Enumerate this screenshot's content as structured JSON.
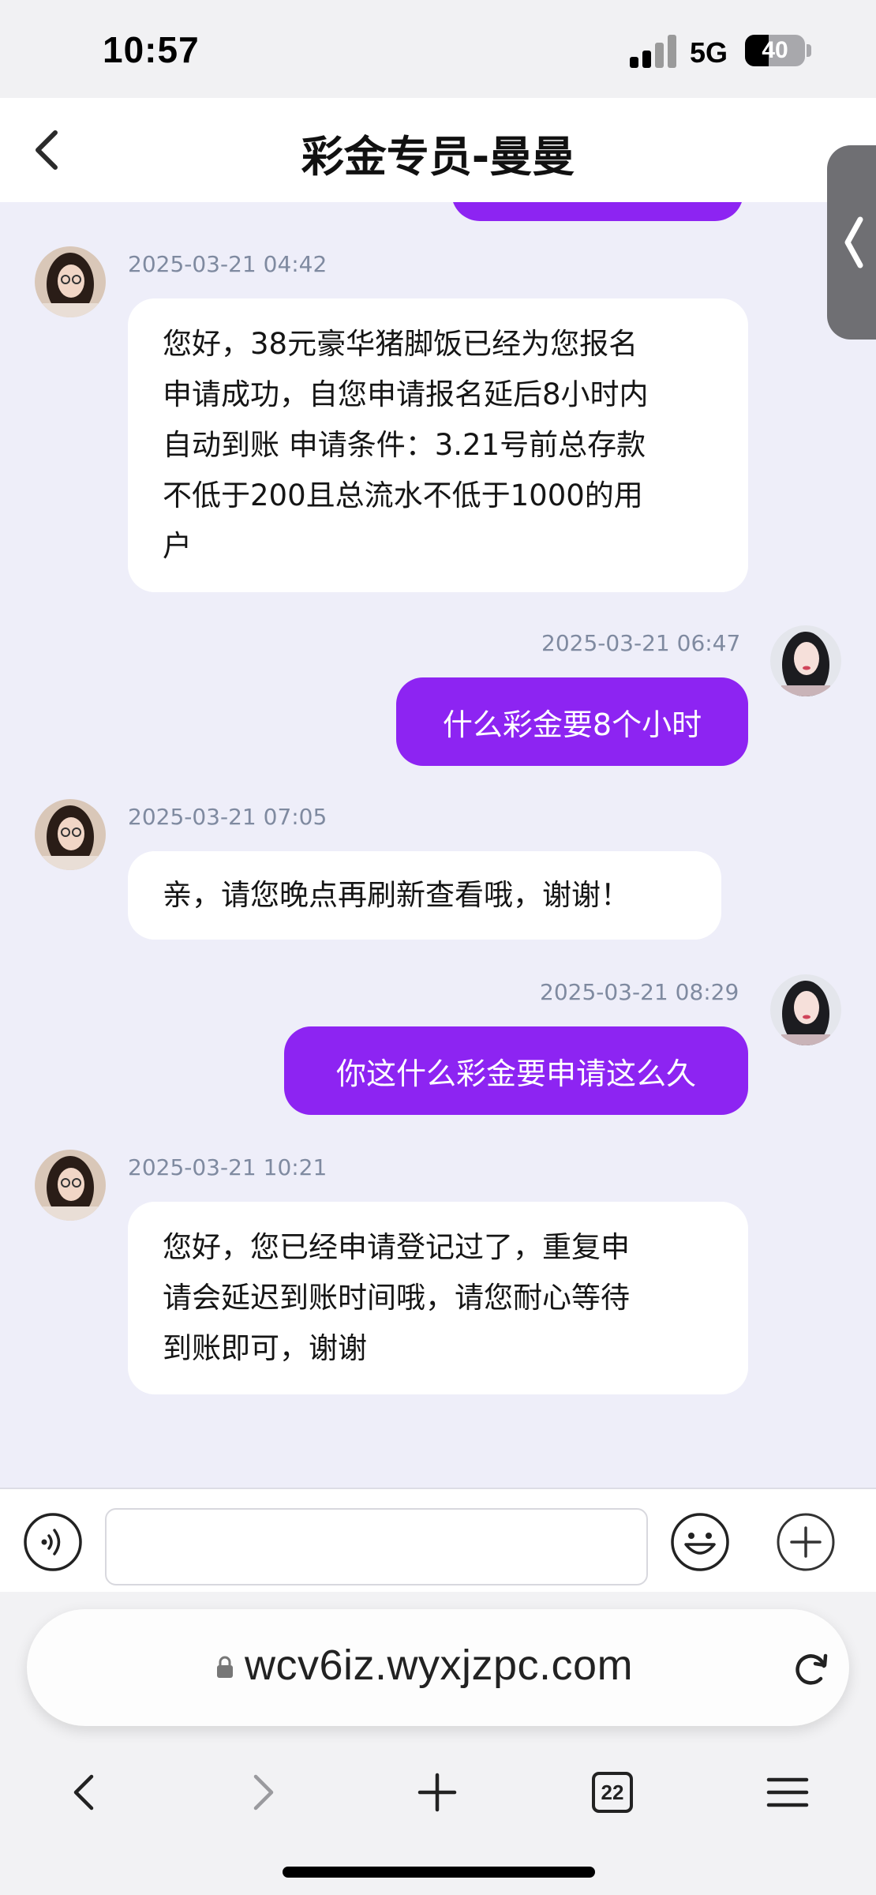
{
  "status_bar": {
    "time": "10:57",
    "network": "5G",
    "battery_level": "40"
  },
  "header": {
    "title": "彩金专员-曼曼"
  },
  "messages": [
    {
      "sender": "agent",
      "timestamp": "2025-03-21 04:42",
      "lines": [
        "您好，38元豪华猪脚饭已经为您报名",
        "申请成功，自您申请报名延后8小时内",
        "自动到账 申请条件：3.21号前总存款",
        "不低于200且总流水不低于1000的用",
        "户"
      ]
    },
    {
      "sender": "user",
      "timestamp": "2025-03-21 06:47",
      "text": "什么彩金要8个小时"
    },
    {
      "sender": "agent",
      "timestamp": "2025-03-21 07:05",
      "text": "亲，请您晚点再刷新查看哦，谢谢！"
    },
    {
      "sender": "user",
      "timestamp": "2025-03-21 08:29",
      "text": "你这什么彩金要申请这么久"
    },
    {
      "sender": "agent",
      "timestamp": "2025-03-21 10:21",
      "lines": [
        "您好，您已经申请登记过了，重复申",
        "请会延迟到账时间哦，请您耐心等待",
        "到账即可，谢谢"
      ]
    }
  ],
  "input": {
    "value": "",
    "placeholder": ""
  },
  "browser": {
    "url": "wcv6iz.wyxjzpc.com",
    "tab_count": "22"
  },
  "colors": {
    "accent": "#8d24f2",
    "chat_bg": "#eeeef9",
    "timestamp": "#7f8aa0"
  },
  "icons": [
    "back-arrow-icon",
    "voice-icon",
    "emoji-icon",
    "plus-circle-icon",
    "lock-icon",
    "reload-icon",
    "browser-back-icon",
    "browser-forward-icon",
    "new-tab-icon",
    "tabs-icon",
    "menu-icon"
  ]
}
